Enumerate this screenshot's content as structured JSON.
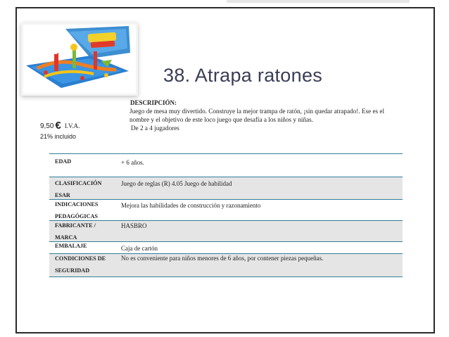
{
  "title": "38. Atrapa ratones",
  "price": {
    "amount": "9,50",
    "currency": "€",
    "tax_label": "I.V.A.",
    "tax_note": "21% incluido"
  },
  "description": {
    "heading": "DESCRIPCIÓN:",
    "lines": [
      "Juego de mesa muy divertido. Construye la mejor trampa de ratón, ¡sin quedar atrapado!. Ese es el",
      "nombre y el objetivo de este loco juego que desafía a los niños y niñas.",
      "De 2 a 4 jugadores"
    ]
  },
  "table": [
    {
      "key_lines": [
        "EDAD"
      ],
      "value": "+ 6 años."
    },
    {
      "key_lines": [
        "CLASIFICACIÓN",
        "ESAR"
      ],
      "value": "Juego de reglas (R) 4.05 Juego de habilidad"
    },
    {
      "key_lines": [
        "INDICACIONES",
        "PEDAGÓGICAS"
      ],
      "value": "Mejora las habilidades de construcción y razonamiento"
    },
    {
      "key_lines": [
        "FABRICANTE /",
        "MARCA"
      ],
      "value": "HASBRO"
    },
    {
      "key_lines": [
        "EMBALAJE"
      ],
      "value": "Caja de cartón"
    },
    {
      "key_lines": [
        "CONDICIONES DE",
        "SEGURIDAD"
      ],
      "value": "No es conveniente para niños menores de 6 años, por contener piezas pequeñas."
    }
  ],
  "colors": {
    "title": "#3a3d55",
    "rule": "#2f7f9a",
    "shade": "#e5e5e5"
  }
}
